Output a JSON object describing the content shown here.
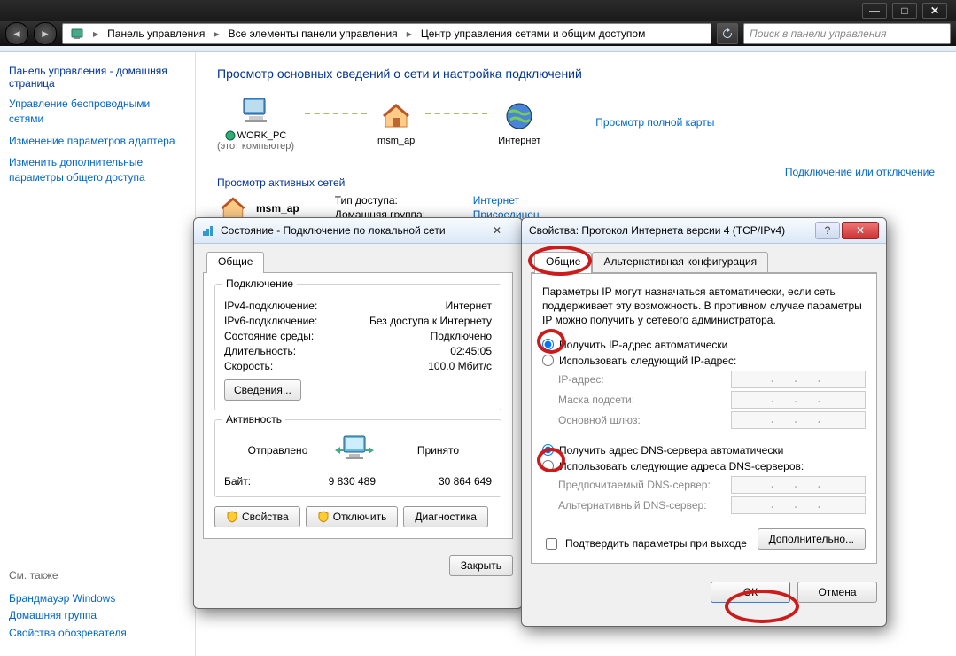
{
  "chrome": {
    "min": "—",
    "max": "□",
    "close": "✕"
  },
  "breadcrumb": {
    "seg1": "Панель управления",
    "seg2": "Все элементы панели управления",
    "seg3": "Центр управления сетями и общим доступом"
  },
  "search_placeholder": "Поиск в панели управления",
  "sidebar": {
    "home": "Панель управления - домашняя страница",
    "links": [
      "Управление беспроводными сетями",
      "Изменение параметров адаптера",
      "Изменить дополнительные параметры общего доступа"
    ],
    "see_also": "См. также",
    "footer": [
      "Брандмауэр Windows",
      "Домашняя группа",
      "Свойства обозревателя"
    ]
  },
  "content": {
    "title": "Просмотр основных сведений о сети и настройка подключений",
    "map": {
      "pc": "WORK_PC",
      "pc_sub": "(этот компьютер)",
      "ap": "msm_ap",
      "internet": "Интернет",
      "full_map": "Просмотр полной карты"
    },
    "active_head": "Просмотр активных сетей",
    "connect_link": "Подключение или отключение",
    "network_name": "msm_ap",
    "details": {
      "access_k": "Тип доступа:",
      "access_v": "Интернет",
      "home_k": "Домашняя группа:",
      "home_v": "Присоединен"
    }
  },
  "dlg_status": {
    "title": "Состояние - Подключение по локальной сети",
    "tab": "Общие",
    "grp1": "Подключение",
    "ipv4_k": "IPv4-подключение:",
    "ipv4_v": "Интернет",
    "ipv6_k": "IPv6-подключение:",
    "ipv6_v": "Без доступа к Интернету",
    "media_k": "Состояние среды:",
    "media_v": "Подключено",
    "dur_k": "Длительность:",
    "dur_v": "02:45:05",
    "speed_k": "Скорость:",
    "speed_v": "100.0 Мбит/с",
    "details_btn": "Сведения...",
    "grp2": "Активность",
    "sent": "Отправлено",
    "recv": "Принято",
    "bytes_k": "Байт:",
    "bytes_sent": "9 830 489",
    "bytes_recv": "30 864 649",
    "props": "Свойства",
    "disable": "Отключить",
    "diag": "Диагностика",
    "close": "Закрыть"
  },
  "dlg_ip": {
    "title": "Свойства: Протокол Интернета версии 4 (TCP/IPv4)",
    "tab1": "Общие",
    "tab2": "Альтернативная конфигурация",
    "para": "Параметры IP могут назначаться автоматически, если сеть поддерживает эту возможность. В противном случае параметры IP можно получить у сетевого администратора.",
    "r_auto_ip": "Получить IP-адрес автоматически",
    "r_manual_ip": "Использовать следующий IP-адрес:",
    "f_ip": "IP-адрес:",
    "f_mask": "Маска подсети:",
    "f_gw": "Основной шлюз:",
    "r_auto_dns": "Получить адрес DNS-сервера автоматически",
    "r_manual_dns": "Использовать следующие адреса DNS-серверов:",
    "f_dns1": "Предпочитаемый DNS-сервер:",
    "f_dns2": "Альтернативный DNS-сервер:",
    "chk_validate": "Подтвердить параметры при выходе",
    "advanced": "Дополнительно...",
    "ok": "ОК",
    "cancel": "Отмена"
  }
}
